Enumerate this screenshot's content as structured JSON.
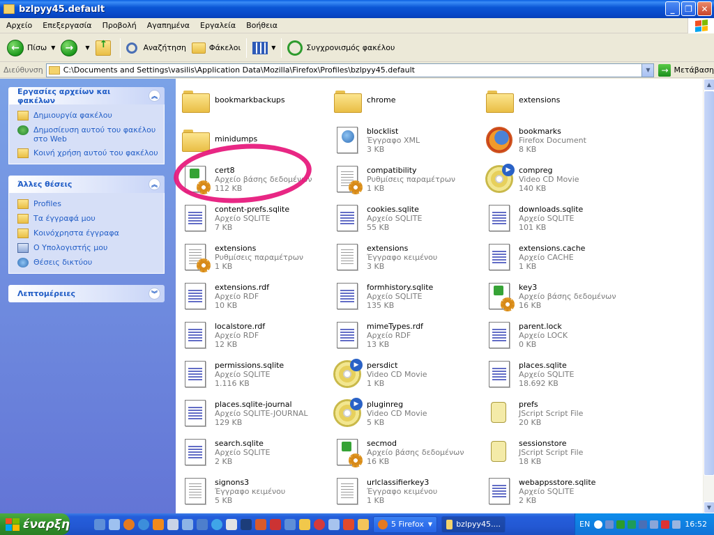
{
  "window": {
    "title": "bzlpyy45.default"
  },
  "menu": [
    "Αρχείο",
    "Επεξεργασία",
    "Προβολή",
    "Αγαπημένα",
    "Εργαλεία",
    "Βοήθεια"
  ],
  "toolbar": {
    "back": "Πίσω",
    "search": "Αναζήτηση",
    "folders": "Φάκελοι",
    "sync": "Συγχρονισμός φακέλου"
  },
  "address": {
    "label": "Διεύθυνση",
    "path": "C:\\Documents and Settings\\vasilis\\Application Data\\Mozilla\\Firefox\\Profiles\\bzlpyy45.default",
    "go": "Μετάβαση"
  },
  "taskpane": {
    "file_tasks": {
      "title": "Εργασίες αρχείων και φακέλων",
      "items": [
        "Δημιουργία φακέλου",
        "Δημοσίευση αυτού του φακέλου στο Web",
        "Κοινή χρήση αυτού του φακέλου"
      ]
    },
    "other_places": {
      "title": "Άλλες θέσεις",
      "items": [
        "Profiles",
        "Τα έγγραφά μου",
        "Κοινόχρηστα έγγραφα",
        "Ο Υπολογιστής μου",
        "Θέσεις δικτύου"
      ]
    },
    "details": {
      "title": "Λεπτομέρειες"
    }
  },
  "files": [
    {
      "name": "bookmarkbackups",
      "type": "",
      "size": "",
      "icon": "folder"
    },
    {
      "name": "chrome",
      "type": "",
      "size": "",
      "icon": "folder"
    },
    {
      "name": "extensions",
      "type": "",
      "size": "",
      "icon": "folder"
    },
    {
      "name": "minidumps",
      "type": "",
      "size": "",
      "icon": "folder"
    },
    {
      "name": "blocklist",
      "type": "Έγγραφο XML",
      "size": "3 KB",
      "icon": "xml"
    },
    {
      "name": "bookmarks",
      "type": "Firefox Document",
      "size": "8 KB",
      "icon": "firefox"
    },
    {
      "name": "cert8",
      "type": "Αρχείο βάσης δεδομένων",
      "size": "112 KB",
      "icon": "db"
    },
    {
      "name": "compatibility",
      "type": "Ρυθμίσεις παραμέτρων",
      "size": "1 KB",
      "icon": "ini"
    },
    {
      "name": "compreg",
      "type": "Video CD Movie",
      "size": "140 KB",
      "icon": "cd"
    },
    {
      "name": "content-prefs.sqlite",
      "type": "Αρχείο SQLITE",
      "size": "7 KB",
      "icon": "grid"
    },
    {
      "name": "cookies.sqlite",
      "type": "Αρχείο SQLITE",
      "size": "55 KB",
      "icon": "grid"
    },
    {
      "name": "downloads.sqlite",
      "type": "Αρχείο SQLITE",
      "size": "101 KB",
      "icon": "grid"
    },
    {
      "name": "extensions",
      "type": "Ρυθμίσεις παραμέτρων",
      "size": "1 KB",
      "icon": "ini"
    },
    {
      "name": "extensions",
      "type": "Έγγραφο κειμένου",
      "size": "3 KB",
      "icon": "txt"
    },
    {
      "name": "extensions.cache",
      "type": "Αρχείο CACHE",
      "size": "1 KB",
      "icon": "grid"
    },
    {
      "name": "extensions.rdf",
      "type": "Αρχείο RDF",
      "size": "10 KB",
      "icon": "grid"
    },
    {
      "name": "formhistory.sqlite",
      "type": "Αρχείο SQLITE",
      "size": "135 KB",
      "icon": "grid"
    },
    {
      "name": "key3",
      "type": "Αρχείο βάσης δεδομένων",
      "size": "16 KB",
      "icon": "db"
    },
    {
      "name": "localstore.rdf",
      "type": "Αρχείο RDF",
      "size": "12 KB",
      "icon": "grid"
    },
    {
      "name": "mimeTypes.rdf",
      "type": "Αρχείο RDF",
      "size": "13 KB",
      "icon": "grid"
    },
    {
      "name": "parent.lock",
      "type": "Αρχείο LOCK",
      "size": "0 KB",
      "icon": "grid"
    },
    {
      "name": "permissions.sqlite",
      "type": "Αρχείο SQLITE",
      "size": "1.116 KB",
      "icon": "grid"
    },
    {
      "name": "persdict",
      "type": "Video CD Movie",
      "size": "1 KB",
      "icon": "cd"
    },
    {
      "name": "places.sqlite",
      "type": "Αρχείο SQLITE",
      "size": "18.692 KB",
      "icon": "grid"
    },
    {
      "name": "places.sqlite-journal",
      "type": "Αρχείο SQLITE-JOURNAL",
      "size": "129 KB",
      "icon": "grid"
    },
    {
      "name": "pluginreg",
      "type": "Video CD Movie",
      "size": "5 KB",
      "icon": "cd"
    },
    {
      "name": "prefs",
      "type": "JScript Script File",
      "size": "20 KB",
      "icon": "script"
    },
    {
      "name": "search.sqlite",
      "type": "Αρχείο SQLITE",
      "size": "2 KB",
      "icon": "grid"
    },
    {
      "name": "secmod",
      "type": "Αρχείο βάσης δεδομένων",
      "size": "16 KB",
      "icon": "db"
    },
    {
      "name": "sessionstore",
      "type": "JScript Script File",
      "size": "18 KB",
      "icon": "script"
    },
    {
      "name": "signons3",
      "type": "Έγγραφο κειμένου",
      "size": "5 KB",
      "icon": "txt"
    },
    {
      "name": "urlclassifierkey3",
      "type": "Έγγραφο κειμένου",
      "size": "1 KB",
      "icon": "txt"
    },
    {
      "name": "webappsstore.sqlite",
      "type": "Αρχείο SQLITE",
      "size": "2 KB",
      "icon": "grid"
    }
  ],
  "taskbar": {
    "start": "έναρξη",
    "buttons": [
      "5 Firefox",
      "bzlpyy45...."
    ],
    "lang": "EN",
    "clock": "16:52"
  },
  "colors": {
    "link": "#215DC6",
    "highlight_ring": "#E6157A",
    "taskbar": "#245EDB"
  }
}
